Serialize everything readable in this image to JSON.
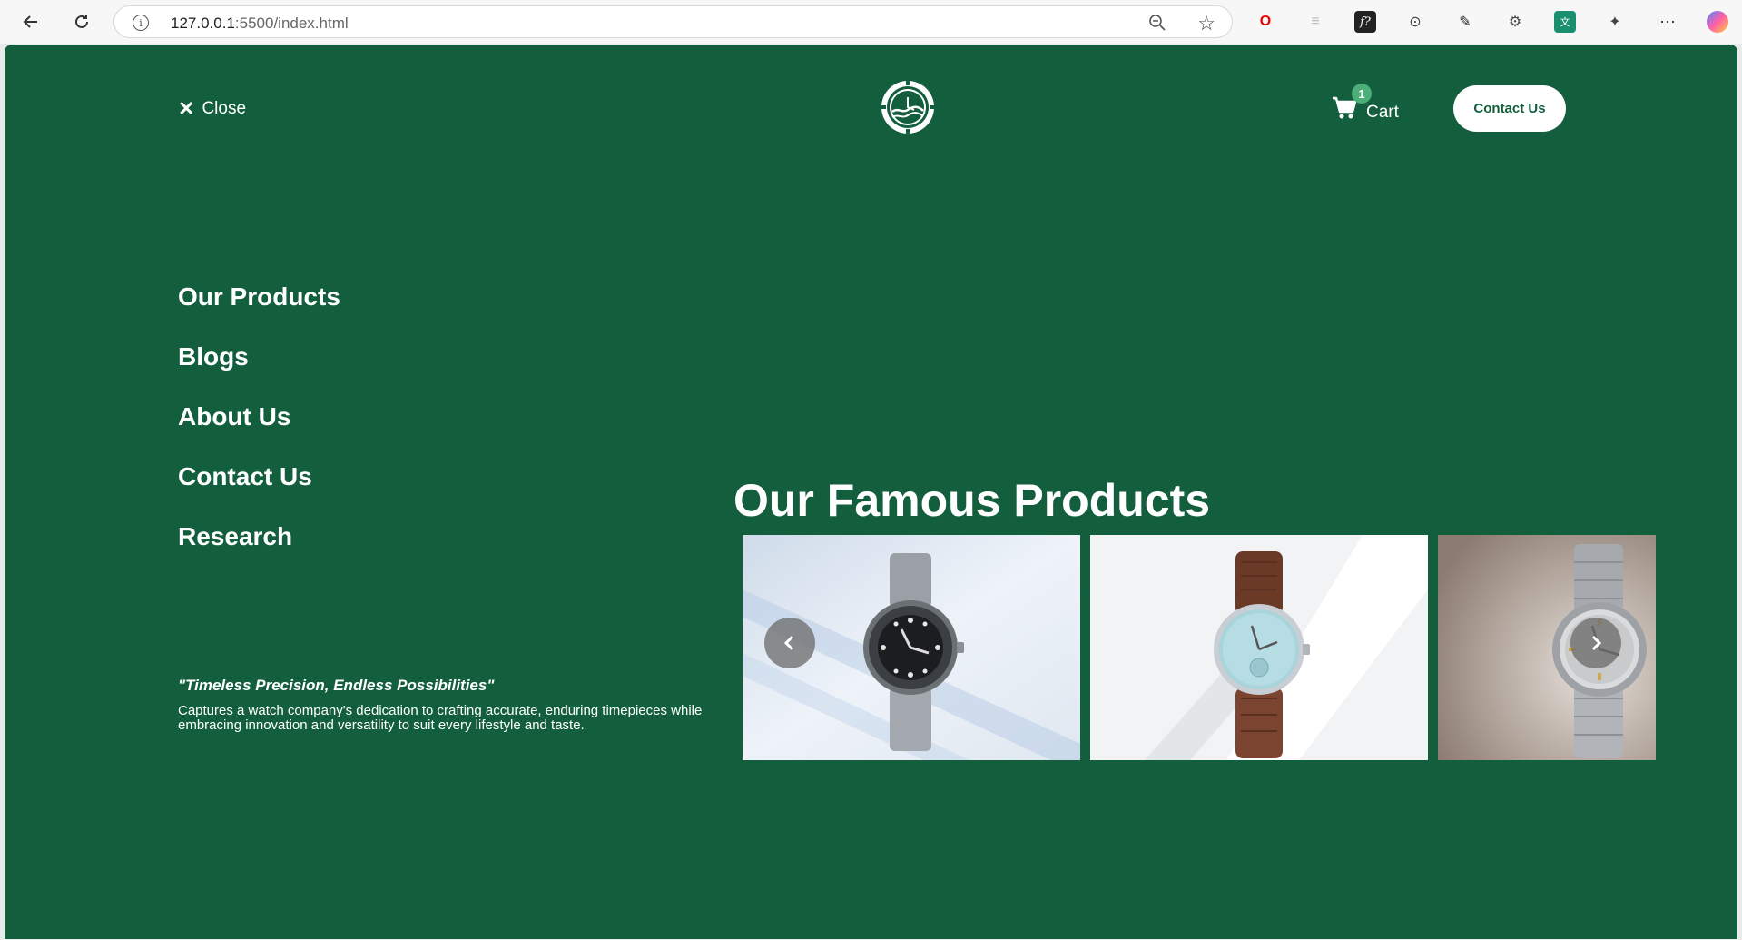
{
  "browser": {
    "url_host": "127.0.0.1",
    "url_rest": ":5500/index.html"
  },
  "header": {
    "close_label": "Close",
    "cart_label": "Cart",
    "cart_count": "1",
    "contact_button": "Contact Us"
  },
  "menu": {
    "items": [
      {
        "label": "Our Products"
      },
      {
        "label": "Blogs"
      },
      {
        "label": "About Us"
      },
      {
        "label": "Contact Us"
      },
      {
        "label": "Research"
      }
    ]
  },
  "tagline": {
    "quote": "\"Timeless Precision, Endless Possibilities\"",
    "description": "Captures a watch company's dedication to crafting accurate, enduring timepieces while embracing innovation and versatility to suit every lifestyle and taste."
  },
  "products": {
    "title": "Our Famous Products",
    "cards": [
      {
        "name": "product-card-black-dial-watch"
      },
      {
        "name": "product-card-blue-dial-leather-watch"
      },
      {
        "name": "product-card-silver-steel-watch"
      }
    ]
  },
  "colors": {
    "page_bg": "#135e3d",
    "badge": "#4caf78",
    "button_text": "#135e3d"
  }
}
